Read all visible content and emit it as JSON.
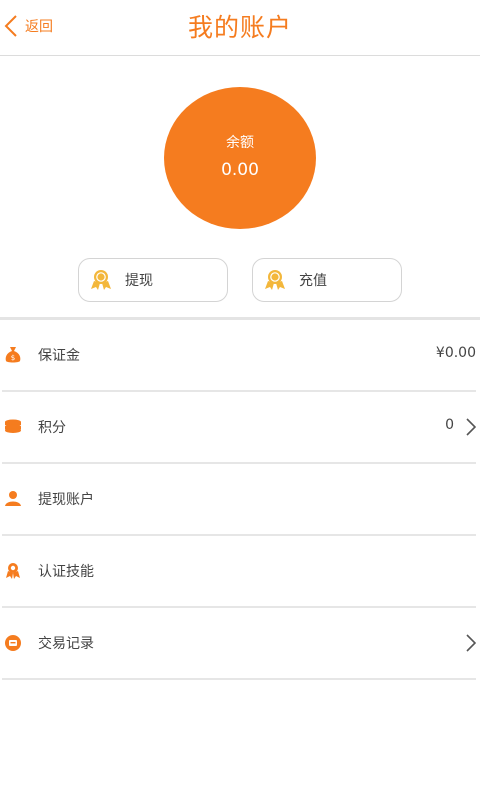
{
  "header": {
    "back_label": "返回",
    "title": "我的账户"
  },
  "balance": {
    "label": "余额",
    "value": "0.00"
  },
  "actions": [
    {
      "label": "提现",
      "icon": "medal-icon"
    },
    {
      "label": "充值",
      "icon": "medal-icon"
    }
  ],
  "menu": [
    {
      "label": "保证金",
      "value": "¥0.00",
      "icon": "money-bag-icon",
      "chevron": false
    },
    {
      "label": "积分",
      "value": "0",
      "icon": "coins-icon",
      "chevron": true
    },
    {
      "label": "提现账户",
      "value": "",
      "icon": "user-icon",
      "chevron": false
    },
    {
      "label": "认证技能",
      "value": "",
      "icon": "certificate-icon",
      "chevron": false
    },
    {
      "label": "交易记录",
      "value": "",
      "icon": "record-icon",
      "chevron": true
    }
  ],
  "colors": {
    "accent": "#f57c1f",
    "divider": "#e6e6e6"
  }
}
